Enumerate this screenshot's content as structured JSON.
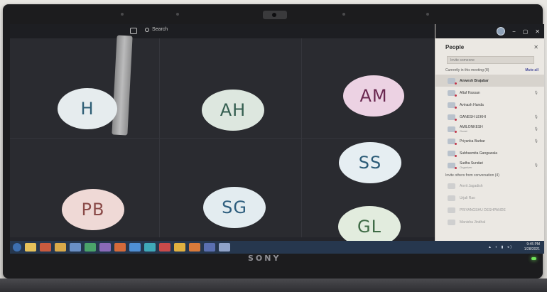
{
  "window": {
    "search_label": "Search",
    "window_controls": [
      "−",
      "▢",
      "✕"
    ]
  },
  "participants_grid": [
    {
      "initials": "H"
    },
    {
      "initials": "AH"
    },
    {
      "initials": "AM"
    },
    {
      "initials": "SS"
    },
    {
      "initials": "PB"
    },
    {
      "initials": "SG"
    },
    {
      "initials": "GL"
    }
  ],
  "people_panel": {
    "title": "People",
    "close": "✕",
    "invite_placeholder": "Invite someone",
    "section_in_meeting": "Currently in this meeting (8)",
    "mute_all": "Mute all",
    "section_others": "Invite others from conversation (4)",
    "members": [
      {
        "name": "Anwesh Brajabar",
        "role": ""
      },
      {
        "name": "Aftaf Hassan",
        "role": ""
      },
      {
        "name": "Avinash Handa",
        "role": ""
      },
      {
        "name": "GANESH LEKHI",
        "role": ""
      },
      {
        "name": "AMILONKESH",
        "role": "Guest"
      },
      {
        "name": "Priyanka Barbar",
        "role": ""
      },
      {
        "name": "Subhasmita Ganguwala",
        "role": ""
      },
      {
        "name": "Sudha Sundari",
        "role": "Organizer"
      }
    ],
    "others": [
      {
        "name": "Anvit Jagadish"
      },
      {
        "name": "Urjali Rao"
      },
      {
        "name": "PRIYANGSHU DESHPANDE"
      },
      {
        "name": "Manisha Jindhal"
      }
    ]
  },
  "taskbar": {
    "clock_time": "9:45 PM",
    "clock_date": "1/28/2021"
  },
  "device": {
    "brand": "SONY"
  }
}
